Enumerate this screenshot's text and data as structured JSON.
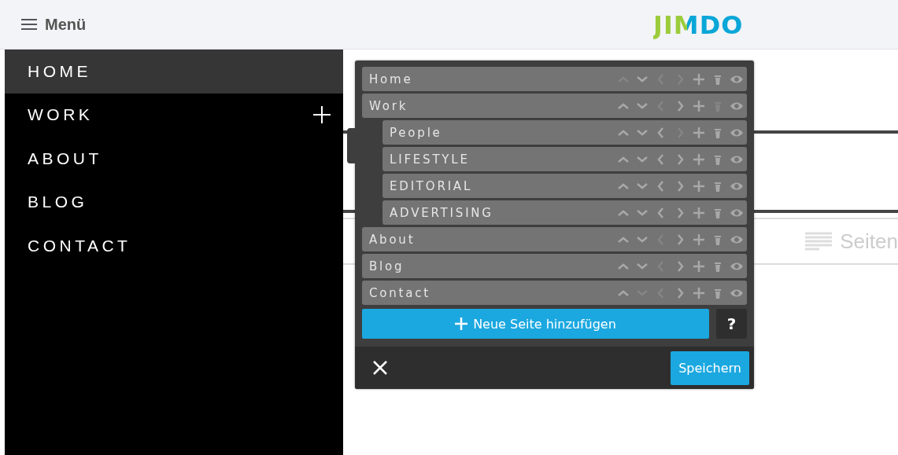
{
  "top_bar": {
    "menu_label": "Menü",
    "logo": "JIMDO"
  },
  "sidebar": {
    "items": [
      {
        "label": "HOME",
        "selected": true,
        "expandable": false
      },
      {
        "label": "WORK",
        "selected": false,
        "expandable": true
      },
      {
        "label": "ABOUT",
        "selected": false,
        "expandable": false
      },
      {
        "label": "BLOG",
        "selected": false,
        "expandable": false
      },
      {
        "label": "CONTACT",
        "selected": false,
        "expandable": false
      }
    ]
  },
  "content": {
    "section_label": "Seiten"
  },
  "page_editor": {
    "pages": [
      {
        "label": "Home",
        "actions": {
          "up": false,
          "down": true,
          "left": false,
          "right": false,
          "add": true,
          "delete": true,
          "visible": true
        }
      },
      {
        "label": "Work",
        "actions": {
          "up": true,
          "down": true,
          "left": false,
          "right": true,
          "add": true,
          "delete": false,
          "visible": true
        },
        "children": [
          {
            "label": "People",
            "actions": {
              "up": true,
              "down": true,
              "left": true,
              "right": false,
              "add": true,
              "delete": true,
              "visible": true
            }
          },
          {
            "label": "LIFESTYLE",
            "actions": {
              "up": true,
              "down": true,
              "left": true,
              "right": true,
              "add": true,
              "delete": true,
              "visible": true
            }
          },
          {
            "label": "EDITORIAL",
            "actions": {
              "up": true,
              "down": true,
              "left": true,
              "right": true,
              "add": true,
              "delete": true,
              "visible": true
            }
          },
          {
            "label": "ADVERTISING",
            "actions": {
              "up": true,
              "down": true,
              "left": true,
              "right": true,
              "add": true,
              "delete": true,
              "visible": true
            }
          }
        ]
      },
      {
        "label": "About",
        "actions": {
          "up": true,
          "down": true,
          "left": false,
          "right": true,
          "add": true,
          "delete": true,
          "visible": true
        }
      },
      {
        "label": "Blog",
        "actions": {
          "up": true,
          "down": true,
          "left": false,
          "right": true,
          "add": true,
          "delete": true,
          "visible": true
        }
      },
      {
        "label": "Contact",
        "actions": {
          "up": true,
          "down": false,
          "left": false,
          "right": true,
          "add": true,
          "delete": true,
          "visible": true
        }
      }
    ],
    "add_button": "Neue Seite hinzufügen",
    "help_button": "?",
    "save_button": "Speichern"
  }
}
